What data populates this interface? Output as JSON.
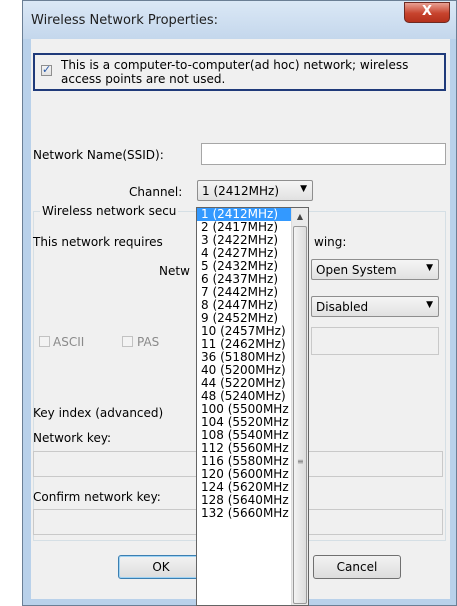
{
  "window": {
    "title": "Wireless Network Properties:",
    "close_label": "X"
  },
  "adhoc": {
    "checked": true,
    "label": "This is a computer-to-computer(ad hoc) network; wireless access points are not used."
  },
  "ssid": {
    "label": "Network Name(SSID):",
    "value": ""
  },
  "channel": {
    "label": "Channel:",
    "selected": "1 (2412MHz)",
    "options": [
      "1 (2412MHz)",
      "2 (2417MHz)",
      "3 (2422MHz)",
      "4 (2427MHz)",
      "5 (2432MHz)",
      "6 (2437MHz)",
      "7 (2442MHz)",
      "8 (2447MHz)",
      "9 (2452MHz)",
      "10 (2457MHz)",
      "11 (2462MHz)",
      "36 (5180MHz)",
      "40 (5200MHz)",
      "44 (5220MHz)",
      "48 (5240MHz)",
      "100 (5500MHz",
      "104 (5520MHz",
      "108 (5540MHz",
      "112 (5560MHz",
      "116 (5580MHz",
      "120 (5600MHz",
      "124 (5620MHz",
      "128 (5640MHz",
      "132 (5660MHz"
    ]
  },
  "security": {
    "group_label": "Wireless network secu",
    "requires_label": "This network requires",
    "requires_suffix": "wing:",
    "auth_label": "Netw",
    "auth_value": "Open System",
    "encryption_value": "Disabled",
    "ascii_label": "ASCII",
    "passphrase_label": "PAS",
    "key_index_label": "Key index (advanced)",
    "network_key_label": "Network key:",
    "confirm_key_label": "Confirm network key:"
  },
  "buttons": {
    "ok": "OK",
    "cancel": "Cancel"
  }
}
